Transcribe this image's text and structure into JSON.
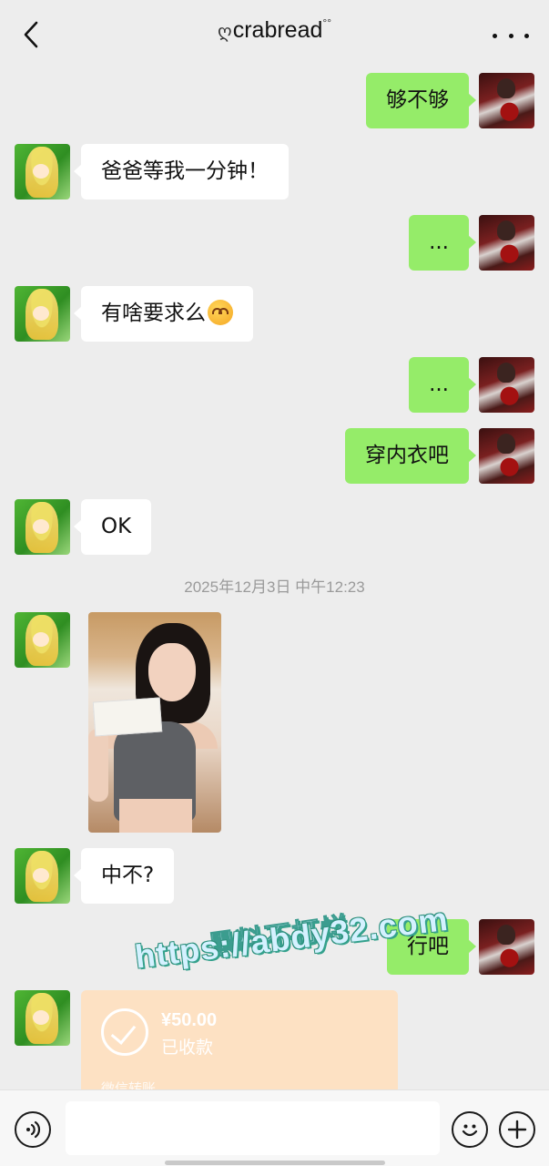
{
  "header": {
    "title": "crabread",
    "title_prefix": "ღ",
    "title_suffix": "°°",
    "back_icon": "chevron-left-icon",
    "more_icon": "more-dots-icon"
  },
  "messages": [
    {
      "side": "right",
      "text": "够不够"
    },
    {
      "side": "left",
      "text": "爸爸等我一分钟！"
    },
    {
      "side": "right",
      "text": "..."
    },
    {
      "side": "left",
      "text": "有啥要求么",
      "emoji": "heart-eyes-emoji"
    },
    {
      "side": "right",
      "text": "..."
    },
    {
      "side": "right",
      "text": "穿内衣吧"
    },
    {
      "side": "left",
      "text": "OK"
    },
    {
      "side": "left",
      "type": "image"
    },
    {
      "side": "left",
      "text": "中不?"
    },
    {
      "side": "right",
      "text": "行吧"
    }
  ],
  "timestamp": "2025年12月3日 中午12:23",
  "transfer": {
    "amount": "¥50.00",
    "status": "已收款",
    "source": "微信转账"
  },
  "watermark": {
    "line1": "黑料不打烊",
    "line2": "https://abdy32.com"
  },
  "input_bar": {
    "text_value": "",
    "voice_icon": "voice-icon",
    "emoji_icon": "emoji-icon",
    "plus_icon": "plus-icon"
  },
  "colors": {
    "background": "#ededed",
    "sent_bubble": "#95ec69",
    "received_bubble": "#ffffff",
    "transfer_card": "#fde1c3"
  }
}
